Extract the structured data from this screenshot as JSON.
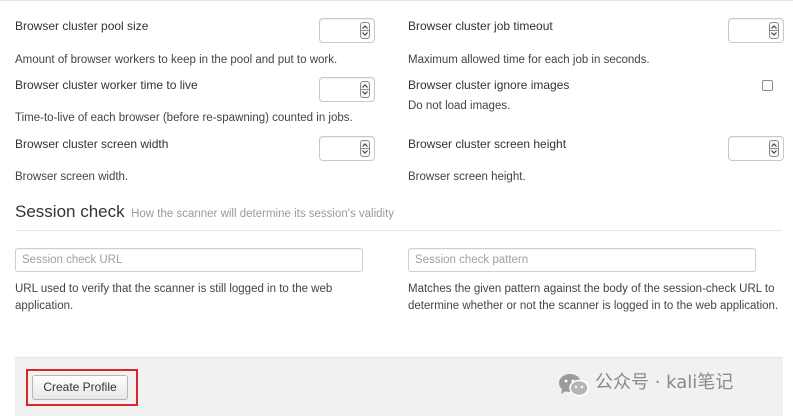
{
  "browser_cluster": {
    "pool_size": {
      "label": "Browser cluster pool size",
      "help": "Amount of browser workers to keep in the pool and put to work.",
      "value": ""
    },
    "job_timeout": {
      "label": "Browser cluster job timeout",
      "help": "Maximum allowed time for each job in seconds.",
      "value": ""
    },
    "worker_ttl": {
      "label": "Browser cluster worker time to live",
      "help": "Time-to-live of each browser (before re-spawning) counted in jobs.",
      "value": ""
    },
    "ignore_images": {
      "label": "Browser cluster ignore images",
      "help": "Do not load images.",
      "checked": false
    },
    "screen_width": {
      "label": "Browser cluster screen width",
      "help": "Browser screen width.",
      "value": ""
    },
    "screen_height": {
      "label": "Browser cluster screen height",
      "help": "Browser screen height.",
      "value": ""
    }
  },
  "session_check": {
    "title": "Session check",
    "subtitle": "How the scanner will determine its session's validity",
    "url": {
      "placeholder": "Session check URL",
      "value": "",
      "help": "URL used to verify that the scanner is still logged in to the web application."
    },
    "pattern": {
      "placeholder": "Session check pattern",
      "value": "",
      "help": "Matches the given pattern against the body of the session-check URL to determine whether or not the scanner is logged in to the web application."
    }
  },
  "footer": {
    "create_label": "Create Profile"
  },
  "watermark": {
    "text": "公众号 · kali笔记",
    "icon": "wechat-icon"
  },
  "colors": {
    "highlight": "#d9242b",
    "footer_bg": "#f1f1f1"
  }
}
